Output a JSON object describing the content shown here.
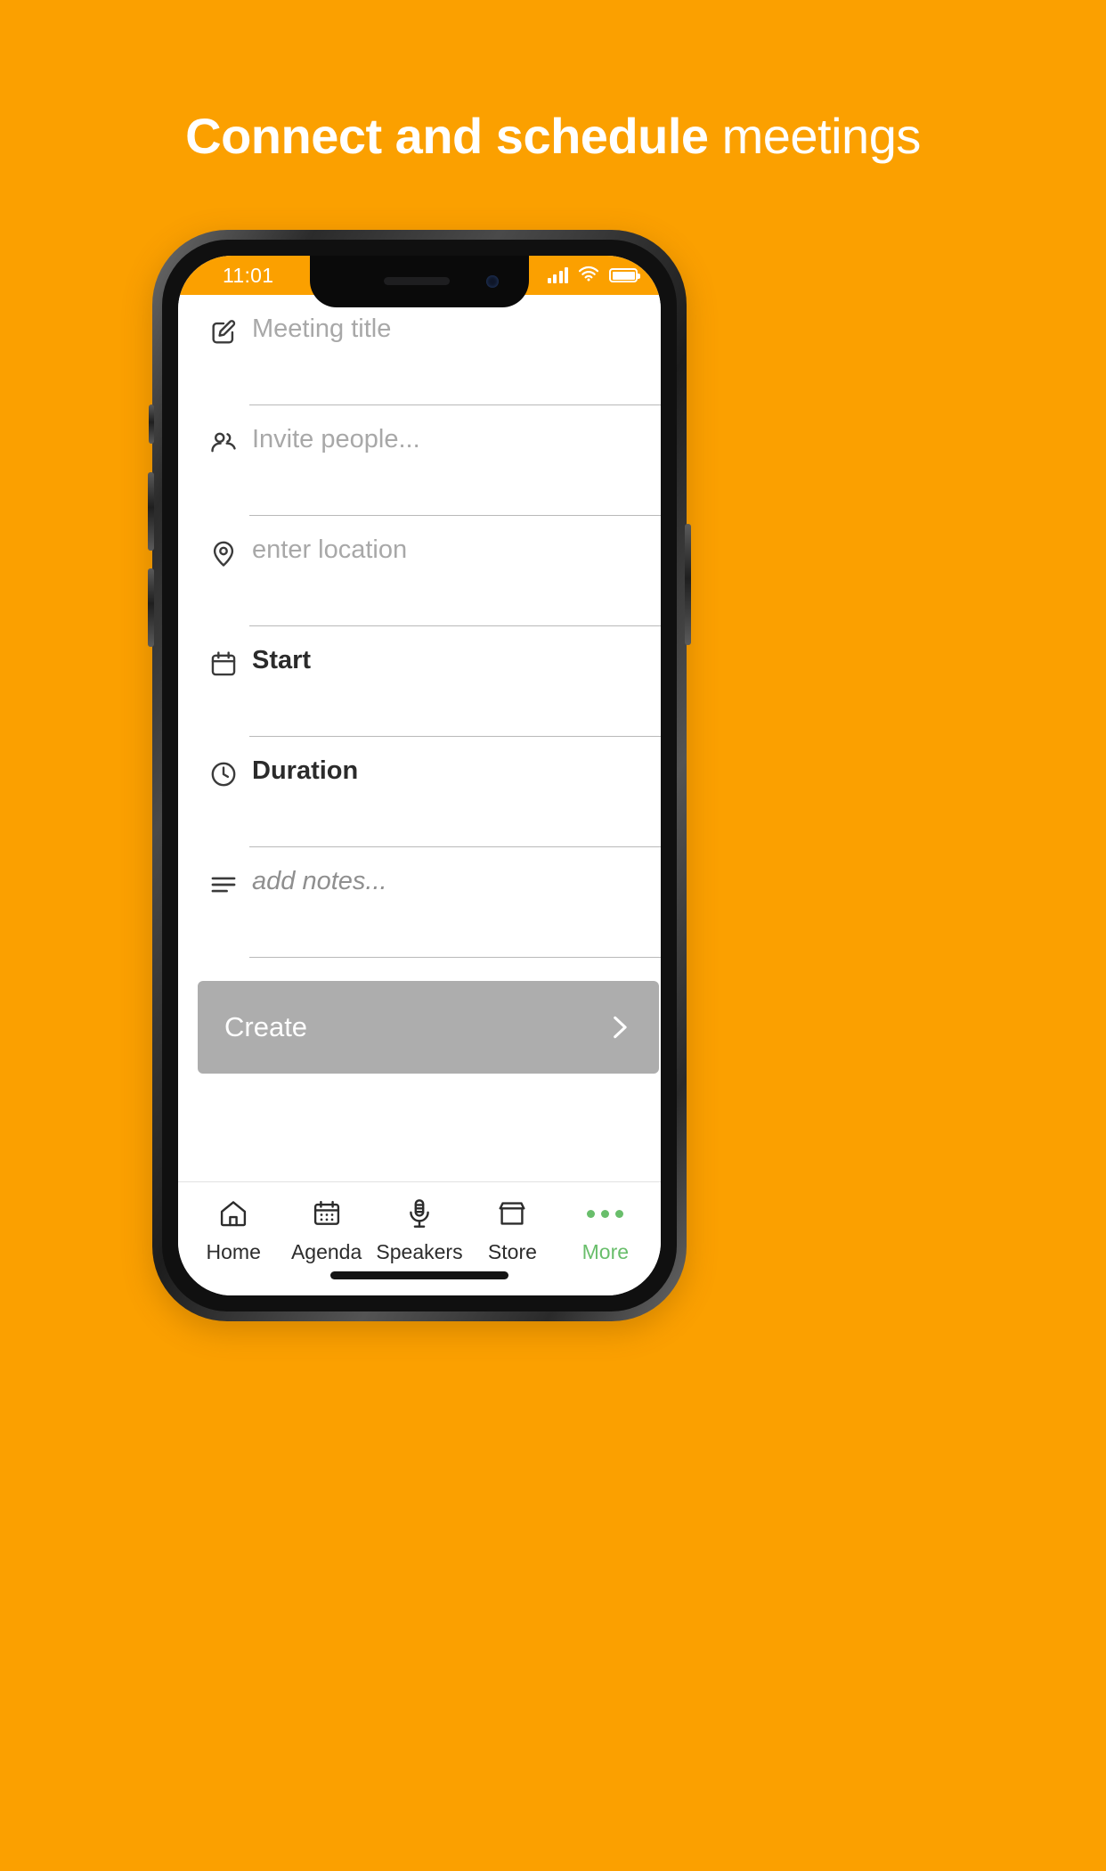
{
  "page": {
    "background_color": "#FBA000",
    "headline_bold": "Connect and schedule",
    "headline_light": " meetings"
  },
  "status_bar": {
    "time": "11:01",
    "background_color": "#FBA000",
    "signal_icon": "cellular-signal-icon",
    "wifi_icon": "wifi-icon",
    "battery_icon": "battery-full-icon"
  },
  "form": {
    "fields": [
      {
        "icon": "edit-square-icon",
        "text": "Meeting title",
        "style": "placeholder"
      },
      {
        "icon": "people-icon",
        "text": "Invite people...",
        "style": "placeholder"
      },
      {
        "icon": "location-pin-icon",
        "text": "enter location",
        "style": "placeholder"
      },
      {
        "icon": "calendar-icon",
        "text": "Start",
        "style": "value"
      },
      {
        "icon": "clock-icon",
        "text": "Duration",
        "style": "value"
      },
      {
        "icon": "notes-lines-icon",
        "text": "add notes...",
        "style": "italic-placeholder"
      }
    ]
  },
  "create_button": {
    "label": "Create",
    "arrow_icon": "chevron-right-icon",
    "color": "#ADADAD"
  },
  "tabbar": {
    "active_color": "#69BE6B",
    "items": [
      {
        "label": "Home",
        "icon": "home-icon"
      },
      {
        "label": "Agenda",
        "icon": "calendar-icon"
      },
      {
        "label": "Speakers",
        "icon": "microphone-icon"
      },
      {
        "label": "Store",
        "icon": "storefront-icon"
      },
      {
        "label": "More",
        "icon": "ellipsis-icon"
      }
    ]
  }
}
